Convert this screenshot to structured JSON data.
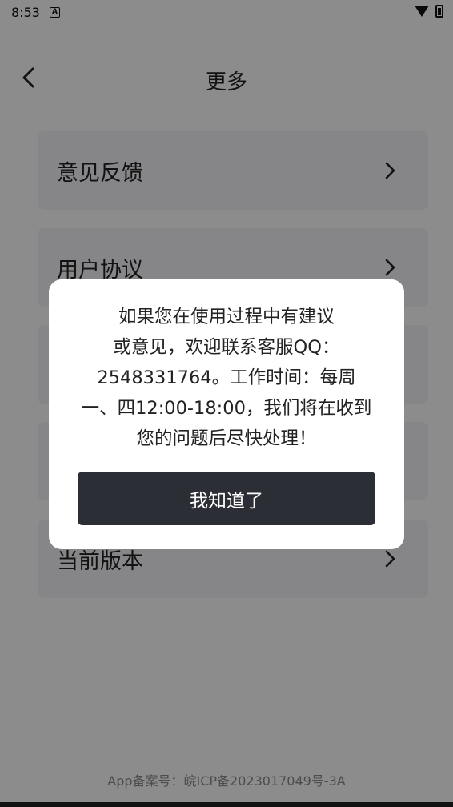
{
  "status_bar": {
    "time": "8:53",
    "notification_icon_label": "A"
  },
  "header": {
    "title": "更多"
  },
  "menu": [
    {
      "label": "意见反馈"
    },
    {
      "label": "用户协议"
    },
    {
      "label": ""
    },
    {
      "label": ""
    },
    {
      "label": "当前版本"
    }
  ],
  "footer": {
    "text": "App备案号：皖ICP备2023017049号-3A"
  },
  "dialog": {
    "message_lines": [
      "如果您在使用过程中有建议",
      "或意见，欢迎联系客服QQ：",
      "2548331764。工作时间：每周",
      "一、四12:00-18:00，我们将在收到",
      "您的问题后尽快处理！"
    ],
    "button_label": "我知道了"
  },
  "colors": {
    "overlay": "rgba(0,0,0,0.45)",
    "button_bg": "#2c2e35",
    "card_bg": "#f5f5f7"
  }
}
